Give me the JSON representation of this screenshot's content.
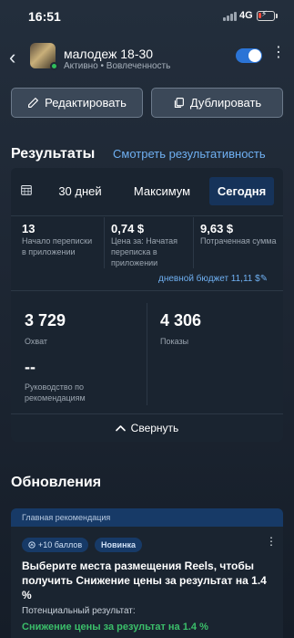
{
  "status_bar": {
    "time": "16:51",
    "network": "4G",
    "battery_level": 0.2
  },
  "header": {
    "campaign_name": "малодеж 18-30",
    "status": "Активно",
    "separator": " • ",
    "objective": "Вовлеченность",
    "toggle_on": true
  },
  "actions": {
    "edit_label": "Редактировать",
    "duplicate_label": "Дублировать"
  },
  "results": {
    "title": "Результаты",
    "link": "Смотреть результативность",
    "segments": [
      "30 дней",
      "Максимум",
      "Сегодня"
    ],
    "selected_segment": "Сегодня",
    "metrics": [
      {
        "value": "13",
        "label": "Начало переписки в приложении"
      },
      {
        "value": "0,74 $",
        "label": "Цена за: Начатая переписка в приложении"
      },
      {
        "value": "9,63 $",
        "label": "Потраченная сумма"
      }
    ],
    "daily_budget": "дневной бюджет 11,11 $",
    "reach_value": "3 729",
    "reach_label": "Охват",
    "impressions_value": "4 306",
    "impressions_label": "Показы",
    "guidance_value": "--",
    "guidance_label": "Руководство по рекомендациям",
    "collapse_label": "Свернуть"
  },
  "updates": {
    "title": "Обновления",
    "card": {
      "header": "Главная рекомендация",
      "points_badge": "+10 баллов",
      "new_badge": "Новинка",
      "text": "Выберите места размещения Reels, чтобы получить Снижение цены за результат на 1.4 %",
      "potential_label": "Потенциальный результат:",
      "potential_value": "Снижение цены за результат на 1.4 %"
    }
  },
  "colors": {
    "accent": "#6fb0f2",
    "toggle": "#2b74d6",
    "active_dot": "#2fbf5b",
    "positive": "#3bbf6a",
    "selected_segment_bg": "#16335a",
    "recommendation_header": "#173a67"
  }
}
